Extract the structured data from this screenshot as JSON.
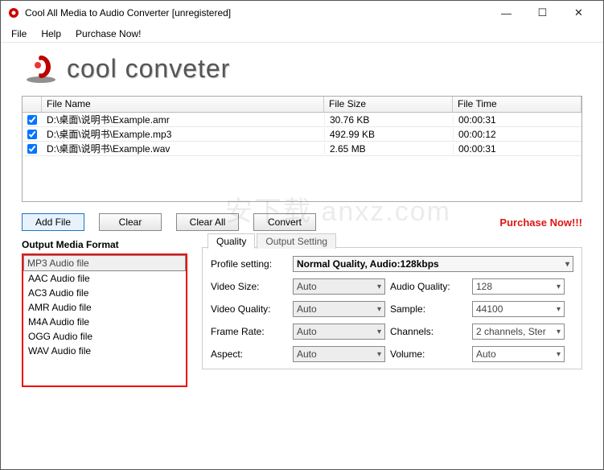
{
  "window": {
    "title": "Cool All Media to Audio Converter  [unregistered]"
  },
  "menu": {
    "file": "File",
    "help": "Help",
    "purchase": "Purchase Now!"
  },
  "logo": {
    "text": "cool conveter"
  },
  "table": {
    "headers": {
      "name": "File Name",
      "size": "File Size",
      "time": "File Time"
    },
    "rows": [
      {
        "name": "D:\\桌面\\说明书\\Example.amr",
        "size": "30.76 KB",
        "time": "00:00:31"
      },
      {
        "name": "D:\\桌面\\说明书\\Example.mp3",
        "size": "492.99 KB",
        "time": "00:00:12"
      },
      {
        "name": "D:\\桌面\\说明书\\Example.wav",
        "size": "2.65 MB",
        "time": "00:00:31"
      }
    ]
  },
  "buttons": {
    "add": "Add File",
    "clear": "Clear",
    "clearall": "Clear All",
    "convert": "Convert",
    "purchase": "Purchase Now!!!"
  },
  "format": {
    "title": "Output Media Format",
    "items": [
      "MP3 Audio file",
      "AAC Audio file",
      "AC3 Audio file",
      "AMR Audio file",
      "M4A Audio file",
      "OGG Audio file",
      "WAV Audio file"
    ]
  },
  "tabs": {
    "quality": "Quality",
    "output": "Output Setting"
  },
  "settings": {
    "profile_label": "Profile setting:",
    "profile_value": "Normal Quality, Audio:128kbps",
    "video_size_label": "Video Size:",
    "video_size_value": "Auto",
    "audio_quality_label": "Audio Quality:",
    "audio_quality_value": "128",
    "video_quality_label": "Video Quality:",
    "video_quality_value": "Auto",
    "sample_label": "Sample:",
    "sample_value": "44100",
    "frame_rate_label": "Frame Rate:",
    "frame_rate_value": "Auto",
    "channels_label": "Channels:",
    "channels_value": "2 channels, Ster",
    "aspect_label": "Aspect:",
    "aspect_value": "Auto",
    "volume_label": "Volume:",
    "volume_value": "Auto"
  },
  "watermark": "安下载 anxz.com"
}
